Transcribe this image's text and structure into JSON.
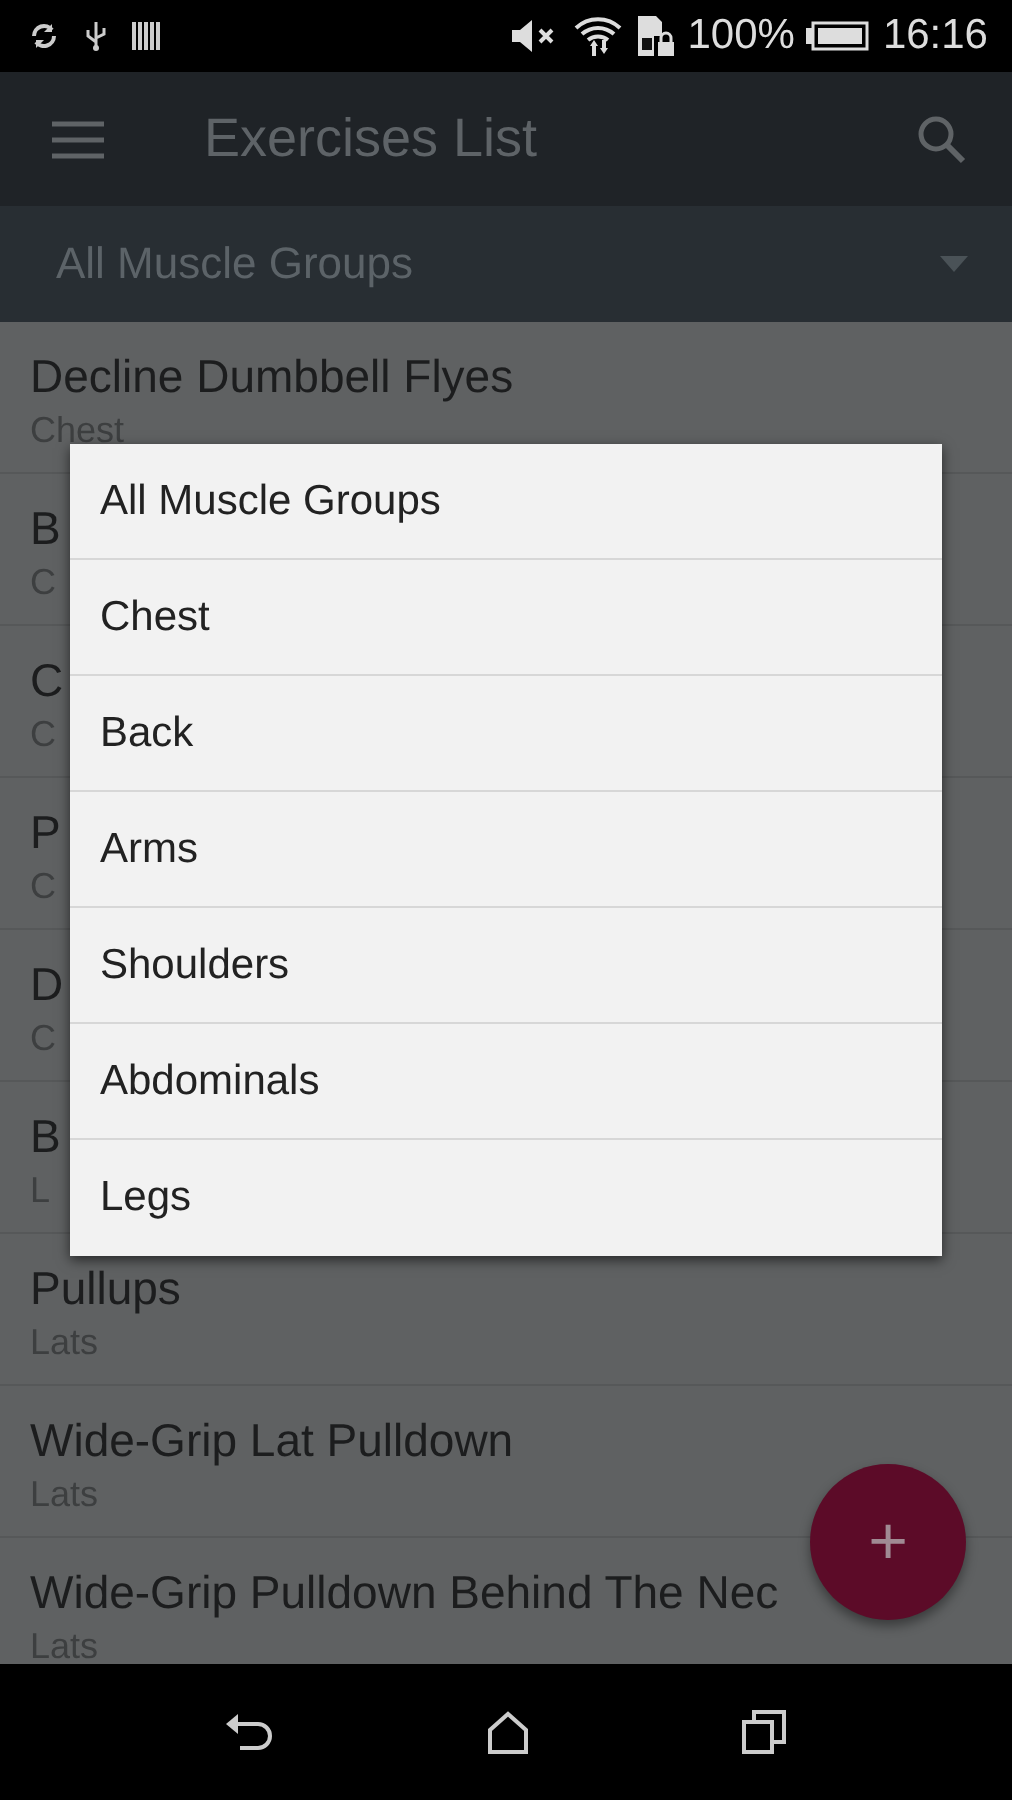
{
  "status_bar": {
    "battery_text": "100%",
    "time": "16:16"
  },
  "toolbar": {
    "title": "Exercises List"
  },
  "filter": {
    "value": "All Muscle Groups"
  },
  "exercises": [
    {
      "name": "Decline Dumbbell Flyes",
      "group": "Chest"
    },
    {
      "name": "B",
      "group": "C"
    },
    {
      "name": "C",
      "group": "C"
    },
    {
      "name": "P",
      "group": "C"
    },
    {
      "name": "D",
      "group": "C"
    },
    {
      "name": "B",
      "group": "L"
    },
    {
      "name": "Pullups",
      "group": "Lats"
    },
    {
      "name": "Wide-Grip Lat Pulldown",
      "group": "Lats"
    },
    {
      "name": "Wide-Grip Pulldown Behind The Nec",
      "group": "Lats"
    }
  ],
  "dropdown": {
    "options": [
      "All Muscle Groups",
      "Chest",
      "Back",
      "Arms",
      "Shoulders",
      "Abdominals",
      "Legs"
    ]
  },
  "fab": {
    "label": "+"
  }
}
